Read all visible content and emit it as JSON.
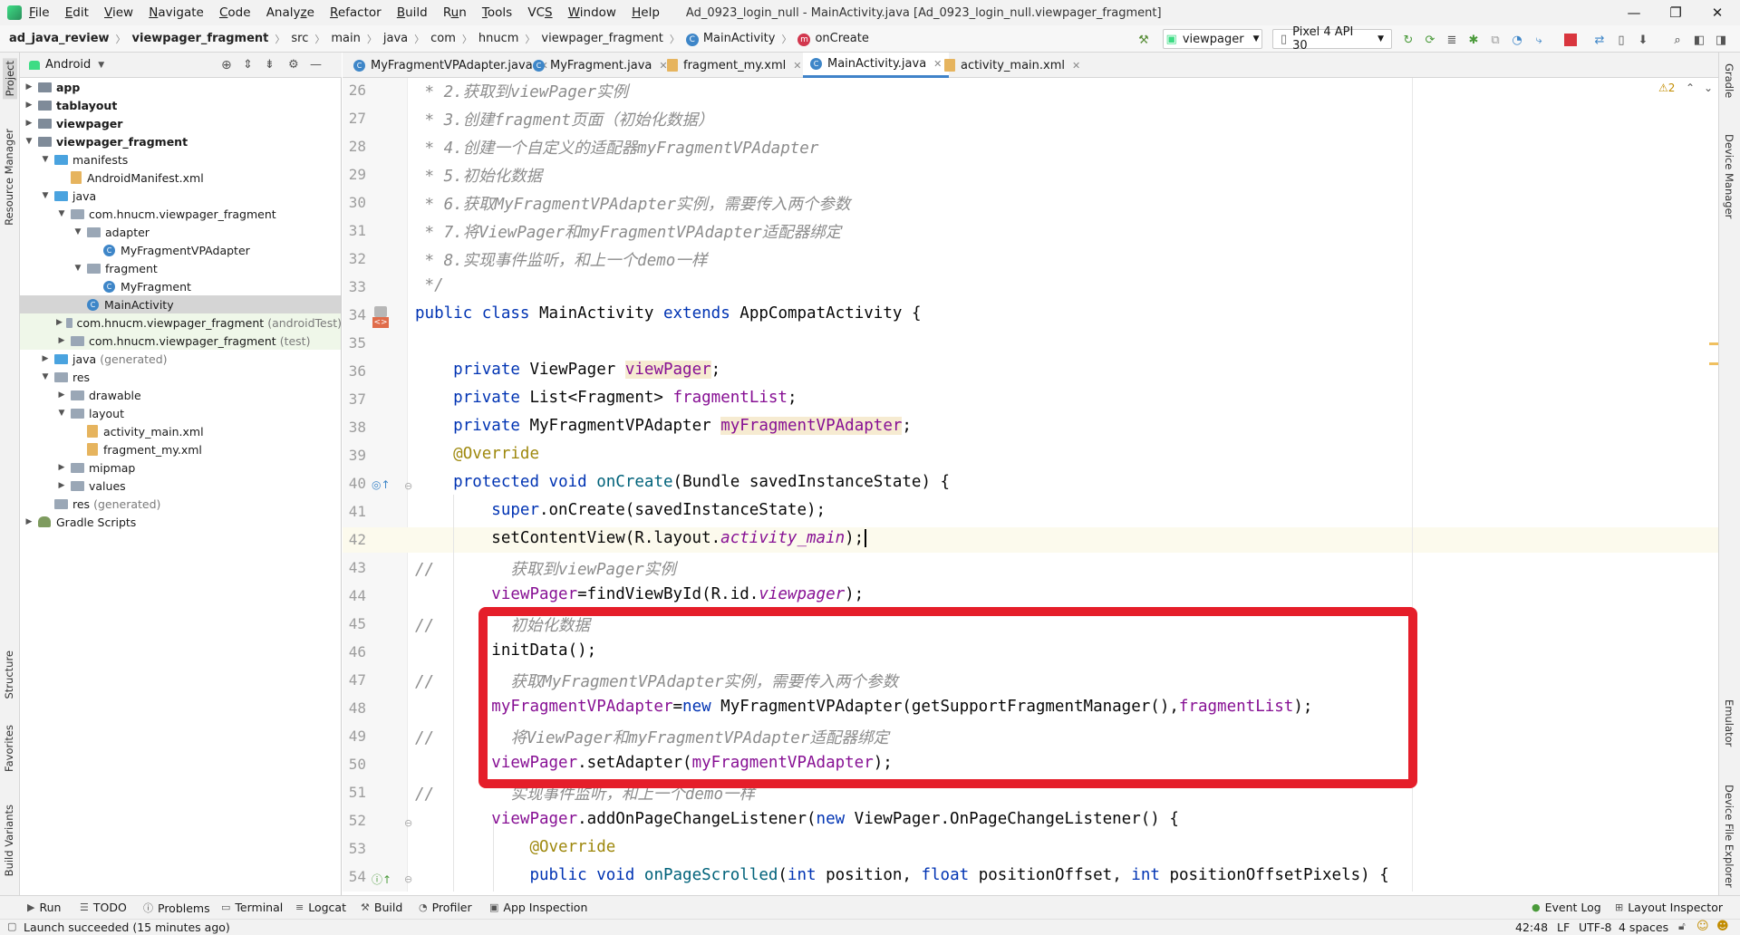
{
  "title_bar": {
    "menus": [
      "File",
      "Edit",
      "View",
      "Navigate",
      "Code",
      "Analyze",
      "Refactor",
      "Build",
      "Run",
      "Tools",
      "VCS",
      "Window",
      "Help"
    ],
    "menu_mnemonics": [
      "F",
      "E",
      "V",
      "N",
      "C",
      "z",
      "R",
      "B",
      "u",
      "T",
      "S",
      "W",
      "H"
    ],
    "window_title": "Ad_0923_login_null - MainActivity.java [Ad_0923_login_null.viewpager_fragment]",
    "controls": {
      "minimize": "—",
      "maximize": "❐",
      "close": "✕"
    }
  },
  "breadcrumb": {
    "items": [
      "ad_java_review",
      "viewpager_fragment",
      "src",
      "main",
      "java",
      "com",
      "hnucm",
      "viewpager_fragment",
      "MainActivity",
      "onCreate"
    ],
    "run_config": "viewpager",
    "device": "Pixel 4 API 30"
  },
  "left_strip": {
    "tabs": [
      "Project",
      "Resource Manager",
      "Structure",
      "Favorites",
      "Build Variants"
    ]
  },
  "project_panel": {
    "view_selector": "Android",
    "tree": [
      {
        "label": "app",
        "bold": true
      },
      {
        "label": "tablayout",
        "bold": true
      },
      {
        "label": "viewpager",
        "bold": true
      },
      {
        "label": "viewpager_fragment",
        "bold": true
      },
      {
        "label": "manifests"
      },
      {
        "label": "AndroidManifest.xml"
      },
      {
        "label": "java"
      },
      {
        "label": "com.hnucm.viewpager_fragment"
      },
      {
        "label": "adapter"
      },
      {
        "label": "MyFragmentVPAdapter"
      },
      {
        "label": "fragment"
      },
      {
        "label": "MyFragment"
      },
      {
        "label": "MainActivity"
      },
      {
        "label": "com.hnucm.viewpager_fragment",
        "suffix": "(androidTest)"
      },
      {
        "label": "com.hnucm.viewpager_fragment",
        "suffix": "(test)"
      },
      {
        "label": "java",
        "suffix": "(generated)"
      },
      {
        "label": "res"
      },
      {
        "label": "drawable"
      },
      {
        "label": "layout"
      },
      {
        "label": "activity_main.xml"
      },
      {
        "label": "fragment_my.xml"
      },
      {
        "label": "mipmap"
      },
      {
        "label": "values"
      },
      {
        "label": "res",
        "suffix": "(generated)"
      },
      {
        "label": "Gradle Scripts"
      }
    ]
  },
  "editor_tabs": [
    "MyFragmentVPAdapter.java",
    "MyFragment.java",
    "fragment_my.xml",
    "MainActivity.java",
    "activity_main.xml"
  ],
  "editor": {
    "warnings": "⚠2",
    "line_numbers": [
      "26",
      "27",
      "28",
      "29",
      "30",
      "31",
      "32",
      "33",
      "34",
      "35",
      "36",
      "37",
      "38",
      "39",
      "40",
      "41",
      "42",
      "43",
      "44",
      "45",
      "46",
      "47",
      "48",
      "49",
      "50",
      "51",
      "52",
      "53",
      "54"
    ],
    "code": {
      "l26": " * 2.获取到viewPager实例",
      "l27": " * 3.创建fragment页面（初始化数据）",
      "l28": " * 4.创建一个自定义的适配器myFragmentVPAdapter",
      "l29": " * 5.初始化数据",
      "l30": " * 6.获取MyFragmentVPAdapter实例，需要传入两个参数",
      "l31": " * 7.将ViewPager和myFragmentVPAdapter适配器绑定",
      "l32": " * 8.实现事件监听，和上一个demo一样",
      "l33": " */",
      "kw_public": "public",
      "kw_class": "class",
      "class_name": "MainActivity",
      "kw_extends": "extends",
      "super_class": "AppCompatActivity {",
      "kw_private": "private",
      "type_viewpager": "ViewPager",
      "f_viewPager": "viewPager",
      "type_list": "List<Fragment>",
      "f_fragmentList": "fragmentList",
      "type_adapter": "MyFragmentVPAdapter",
      "f_myFragmentVPAdapter": "myFragmentVPAdapter",
      "semi": ";",
      "override": "@Override",
      "kw_protected": "protected",
      "kw_void": "void",
      "m_onCreate": "onCreate",
      "oncreate_params": "(Bundle savedInstanceState) {",
      "kw_super": "super",
      "super_call": ".onCreate(savedInstanceState);",
      "set_content": "setContentView(R.layout.",
      "activity_main": "activity_main",
      "close_call": ");",
      "slash": "//",
      "c43": "获取到viewPager实例",
      "find_view": "=findViewById(R.id.",
      "id_viewpager": "viewpager",
      "c45": "初始化数据",
      "init_data": "initData();",
      "c47": "获取MyFragmentVPAdapter实例，需要传入两个参数",
      "new_eq": "=",
      "kw_new": "new",
      "new_adapter": " MyFragmentVPAdapter(getSupportFragmentManager(),",
      "c49": "将ViewPager和myFragmentVPAdapter适配器绑定",
      "set_adapter": ".setAdapter(",
      "c51": "实现事件监听，和上一个demo一样",
      "add_listener": ".addOnPageChangeListener(",
      "listener_cls": " ViewPager.OnPageChangeListener() {",
      "kw_int": "int",
      "kw_float": "float",
      "m_onPageScrolled": "onPageScrolled",
      "p_position": " position, ",
      "p_positionOffset": " positionOffset, ",
      "p_positionOffsetPixels": " positionOffsetPixels) {",
      "open_paren": "("
    }
  },
  "right_strip": {
    "tabs": [
      "Gradle",
      "Device Manager",
      "Emulator",
      "Device File Explorer"
    ]
  },
  "bottom_tools": [
    "Run",
    "TODO",
    "Problems",
    "Terminal",
    "Logcat",
    "Build",
    "Profiler",
    "App Inspection",
    "Event Log",
    "Layout Inspector"
  ],
  "status": {
    "message": "Launch succeeded (15 minutes ago)",
    "position": "42:48",
    "line_sep": "LF",
    "encoding": "UTF-8",
    "indent": "4 spaces"
  },
  "colors": {
    "highlight_box": "#e51e2a",
    "keyword": "#0033b3",
    "field": "#871094",
    "comment": "#8c8c8c",
    "annotation": "#9e880d"
  }
}
